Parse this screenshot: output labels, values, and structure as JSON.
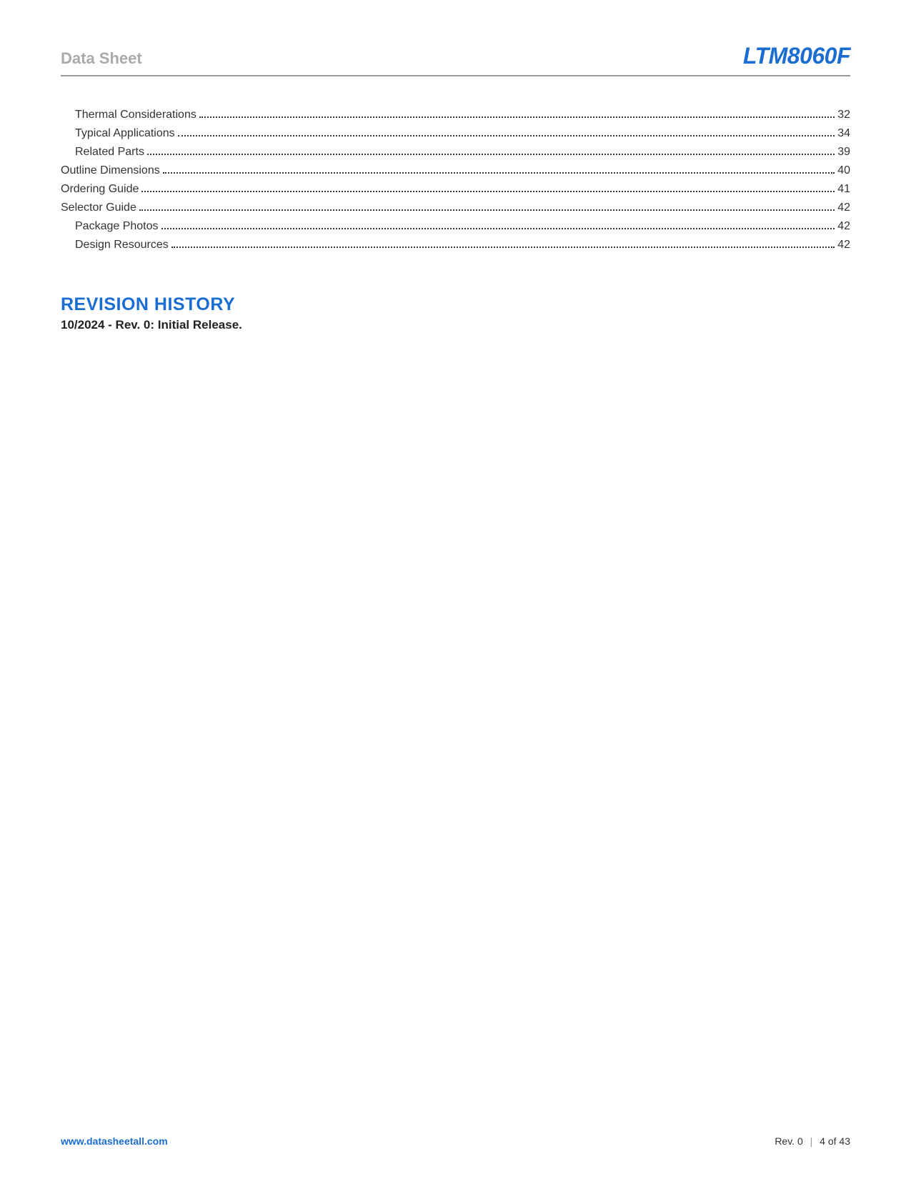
{
  "header": {
    "left": "Data Sheet",
    "right": "LTM8060F"
  },
  "toc": [
    {
      "label": "Thermal Considerations",
      "page": "32",
      "indent": true
    },
    {
      "label": "Typical Applications",
      "page": "34",
      "indent": true
    },
    {
      "label": "Related Parts",
      "page": "39",
      "indent": true
    },
    {
      "label": "Outline Dimensions",
      "page": "40",
      "indent": false
    },
    {
      "label": "Ordering Guide",
      "page": "41",
      "indent": false
    },
    {
      "label": "Selector Guide",
      "page": "42",
      "indent": false
    },
    {
      "label": "Package Photos",
      "page": "42",
      "indent": true
    },
    {
      "label": "Design Resources",
      "page": "42",
      "indent": true
    }
  ],
  "revision": {
    "title": "REVISION HISTORY",
    "text": "10/2024 - Rev. 0: Initial Release."
  },
  "footer": {
    "url": "www.datasheetall.com",
    "rev": "Rev. 0",
    "page": "4 of 43"
  }
}
